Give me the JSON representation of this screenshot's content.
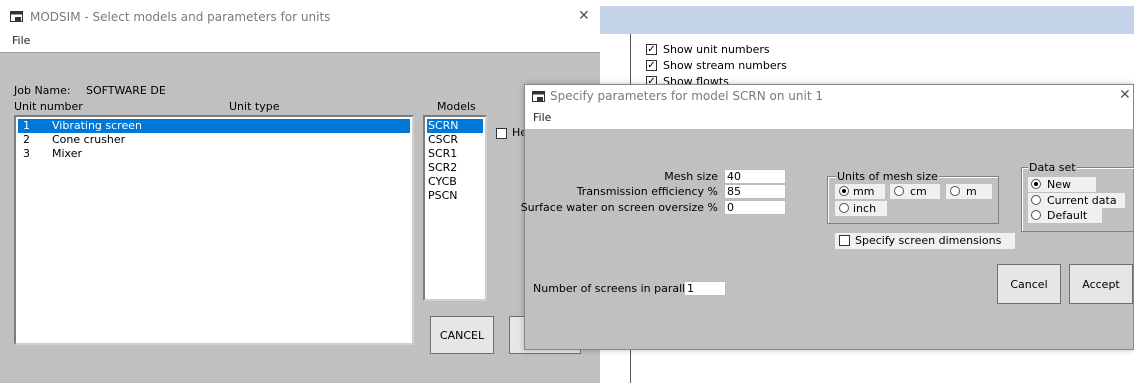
{
  "background_app": {
    "checkboxes": [
      {
        "label": "Show unit numbers",
        "checked": true
      },
      {
        "label": "Show stream numbers",
        "checked": true
      },
      {
        "label": "Show flowts",
        "checked": true
      }
    ]
  },
  "modsim_dialog": {
    "title": "MODSIM - Select models and parameters for units",
    "close_glyph": "✕",
    "menu": {
      "file": "File"
    },
    "job_name_label": "Job Name:",
    "job_name_value": "SOFTWARE DE",
    "unit_number_header": "Unit number",
    "unit_type_header": "Unit type",
    "units": [
      {
        "number": "1",
        "type": "Vibrating screen",
        "selected": true
      },
      {
        "number": "2",
        "type": "Cone crusher",
        "selected": false
      },
      {
        "number": "3",
        "type": "Mixer",
        "selected": false
      }
    ],
    "models_header": "Models",
    "models": [
      {
        "name": "SCRN",
        "selected": true
      },
      {
        "name": "CSCR",
        "selected": false
      },
      {
        "name": "SCR1",
        "selected": false
      },
      {
        "name": "SCR2",
        "selected": false
      },
      {
        "name": "CYCB",
        "selected": false
      },
      {
        "name": "PSCN",
        "selected": false
      }
    ],
    "partial_checkbox_label": "He",
    "cancel_label": "CANCEL"
  },
  "params_dialog": {
    "title": "Specify parameters for model SCRN on unit 1",
    "close_glyph": "✕",
    "menu": {
      "file": "File"
    },
    "mesh_size_label": "Mesh size",
    "mesh_size_value": "40",
    "transmission_label": "Transmission efficiency %",
    "transmission_value": "85",
    "surface_water_label": "Surface water on screen oversize  %",
    "surface_water_value": "0",
    "units_group_label": "Units of mesh size",
    "unit_options": [
      {
        "label": "mm",
        "selected": true
      },
      {
        "label": "cm",
        "selected": false
      },
      {
        "label": "m",
        "selected": false
      },
      {
        "label": "inch",
        "selected": false
      }
    ],
    "dataset_group_label": "Data set",
    "dataset_options": [
      {
        "label": "New",
        "selected": true
      },
      {
        "label": "Current data",
        "selected": false
      },
      {
        "label": "Default",
        "selected": false
      }
    ],
    "screen_dims_label": "Specify screen dimensions",
    "screens_parallel_label": "Number of screens in parallel",
    "screens_parallel_value": "1",
    "cancel_label": "Cancel",
    "accept_label": "Accept"
  }
}
